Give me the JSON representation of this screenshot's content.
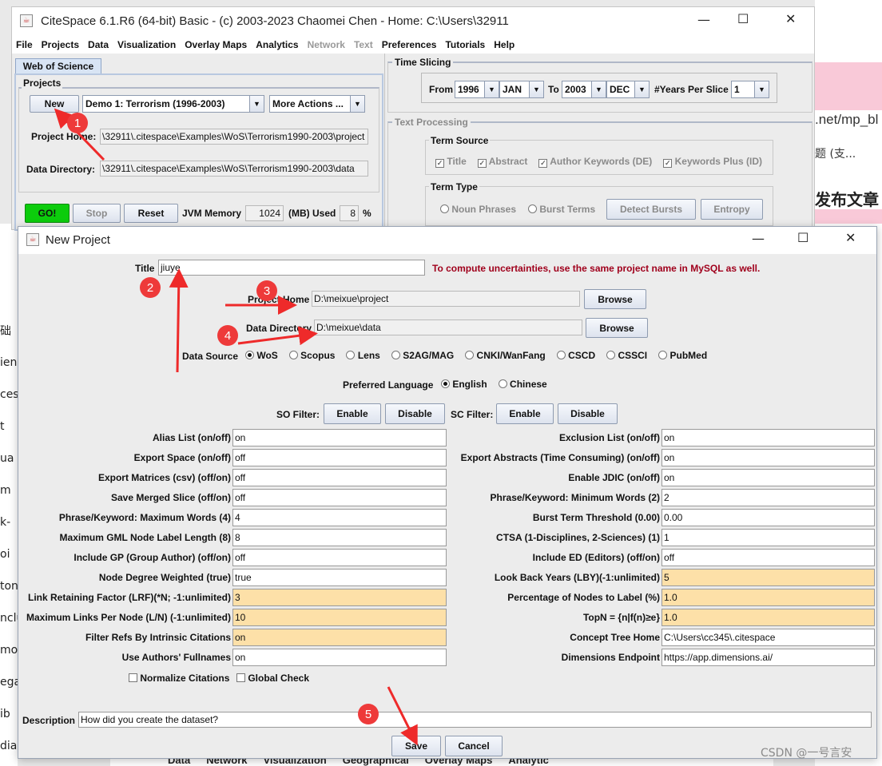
{
  "main": {
    "title": "CiteSpace 6.1.R6 (64-bit) Basic - (c) 2003-2023 Chaomei Chen - Home: C:\\Users\\32911",
    "menu": [
      "File",
      "Projects",
      "Data",
      "Visualization",
      "Overlay Maps",
      "Analytics",
      "Network",
      "Text",
      "Preferences",
      "Tutorials",
      "Help"
    ],
    "tab": "Web of Science",
    "projects_label": "Projects",
    "new_label": "New",
    "project_select": "Demo 1: Terrorism (1996-2003)",
    "more_actions": "More Actions ...",
    "project_home_label": "Project Home:",
    "project_home_value": "\\32911\\.citespace\\Examples\\WoS\\Terrorism1990-2003\\project",
    "data_dir_label": "Data Directory:",
    "data_dir_value": "\\32911\\.citespace\\Examples\\WoS\\Terrorism1990-2003\\data",
    "go": "GO!",
    "stop": "Stop",
    "reset": "Reset",
    "jvm_label": "JVM Memory",
    "jvm_value": "1024",
    "jvm_unit": "(MB) Used",
    "used_value": "8",
    "pct": "%",
    "time_slicing": "Time Slicing",
    "from": "From",
    "from_year": "1996",
    "from_month": "JAN",
    "to": "To",
    "to_year": "2003",
    "to_month": "DEC",
    "years_per_slice": "#Years Per Slice",
    "slice_value": "1",
    "text_processing": "Text Processing",
    "term_source": "Term Source",
    "sources": [
      "Title",
      "Abstract",
      "Author Keywords (DE)",
      "Keywords Plus (ID)"
    ],
    "term_type": "Term Type",
    "noun": "Noun Phrases",
    "burst": "Burst Terms",
    "detect": "Detect Bursts",
    "entropy": "Entropy"
  },
  "bg": {
    "url_fragment": ".net/mp_bl",
    "cn1": "题 (支...",
    "cn2": "发布文章",
    "bottom_menu": [
      "Data",
      "Network",
      "Visualization",
      "Geographical",
      "Overlay Maps",
      "Analytic"
    ],
    "left_fragments": [
      "础",
      "ien",
      "ces",
      "t",
      "ua",
      "m",
      "k-",
      "oi",
      "ton",
      "nclu",
      "mo",
      "ega",
      "ib",
      "dia"
    ],
    "watermark": "CSDN @一号言安"
  },
  "dialog": {
    "title": "New Project",
    "title_label": "Title",
    "title_value": "jiuye",
    "warning": "To compute uncertainties, use the same project name in MySQL as well.",
    "project_home_label": "Project Home",
    "project_home_value": "D:\\meixue\\project",
    "browse": "Browse",
    "data_dir_label": "Data Directory",
    "data_dir_value": "D:\\meixue\\data",
    "data_source_label": "Data Source",
    "data_sources": [
      "WoS",
      "Scopus",
      "Lens",
      "S2AG/MAG",
      "CNKI/WanFang",
      "CSCD",
      "CSSCI",
      "PubMed"
    ],
    "pref_lang_label": "Preferred Language",
    "langs": [
      "English",
      "Chinese"
    ],
    "so_filter": "SO Filter:",
    "sc_filter": "SC Filter:",
    "enable": "Enable",
    "disable": "Disable",
    "left_rows": [
      {
        "label": "Alias List (on/off)",
        "value": "on"
      },
      {
        "label": "Export Space (on/off)",
        "value": "off"
      },
      {
        "label": "Export Matrices (csv) (off/on)",
        "value": "off"
      },
      {
        "label": "Save Merged Slice (off/on)",
        "value": "off"
      },
      {
        "label": "Phrase/Keyword: Maximum Words (4)",
        "value": "4"
      },
      {
        "label": "Maximum GML Node Label Length (8)",
        "value": "8"
      },
      {
        "label": "Include GP (Group Author) (off/on)",
        "value": "off"
      },
      {
        "label": "Node Degree Weighted (true)",
        "value": "true"
      },
      {
        "label": "Link Retaining Factor (LRF)(*N; -1:unlimited)",
        "value": "3"
      },
      {
        "label": "Maximum Links Per Node (L/N) (-1:unlimited)",
        "value": "10"
      },
      {
        "label": "Filter Refs By Intrinsic Citations",
        "value": "on"
      },
      {
        "label": "Use Authors' Fullnames",
        "value": "on"
      }
    ],
    "right_rows": [
      {
        "label": "Exclusion List (on/off)",
        "value": "on"
      },
      {
        "label": "Export Abstracts (Time Consuming) (on/off)",
        "value": "on"
      },
      {
        "label": "Enable JDIC (on/off)",
        "value": "on"
      },
      {
        "label": "Phrase/Keyword: Minimum Words (2)",
        "value": "2"
      },
      {
        "label": "Burst Term Threshold (0.00)",
        "value": "0.00"
      },
      {
        "label": "CTSA (1-Disciplines, 2-Sciences) (1)",
        "value": "1"
      },
      {
        "label": "Include ED (Editors) (off/on)",
        "value": "off"
      },
      {
        "label": "Look Back Years (LBY)(-1:unlimited)",
        "value": "5"
      },
      {
        "label": "Percentage of Nodes to Label (%)",
        "value": "1.0"
      },
      {
        "label": "TopN = {n|f(n)≥e}",
        "value": "1.0"
      },
      {
        "label": "Concept Tree Home",
        "value": "C:\\Users\\cc345\\.citespace"
      },
      {
        "label": "Dimensions Endpoint",
        "value": "https://app.dimensions.ai/"
      }
    ],
    "normalize": "Normalize Citations",
    "global_check": "Global Check",
    "description_label": "Description",
    "description_value": "How did you create the dataset?",
    "save": "Save",
    "cancel": "Cancel"
  },
  "annotations": [
    "1",
    "2",
    "3",
    "4",
    "5"
  ]
}
